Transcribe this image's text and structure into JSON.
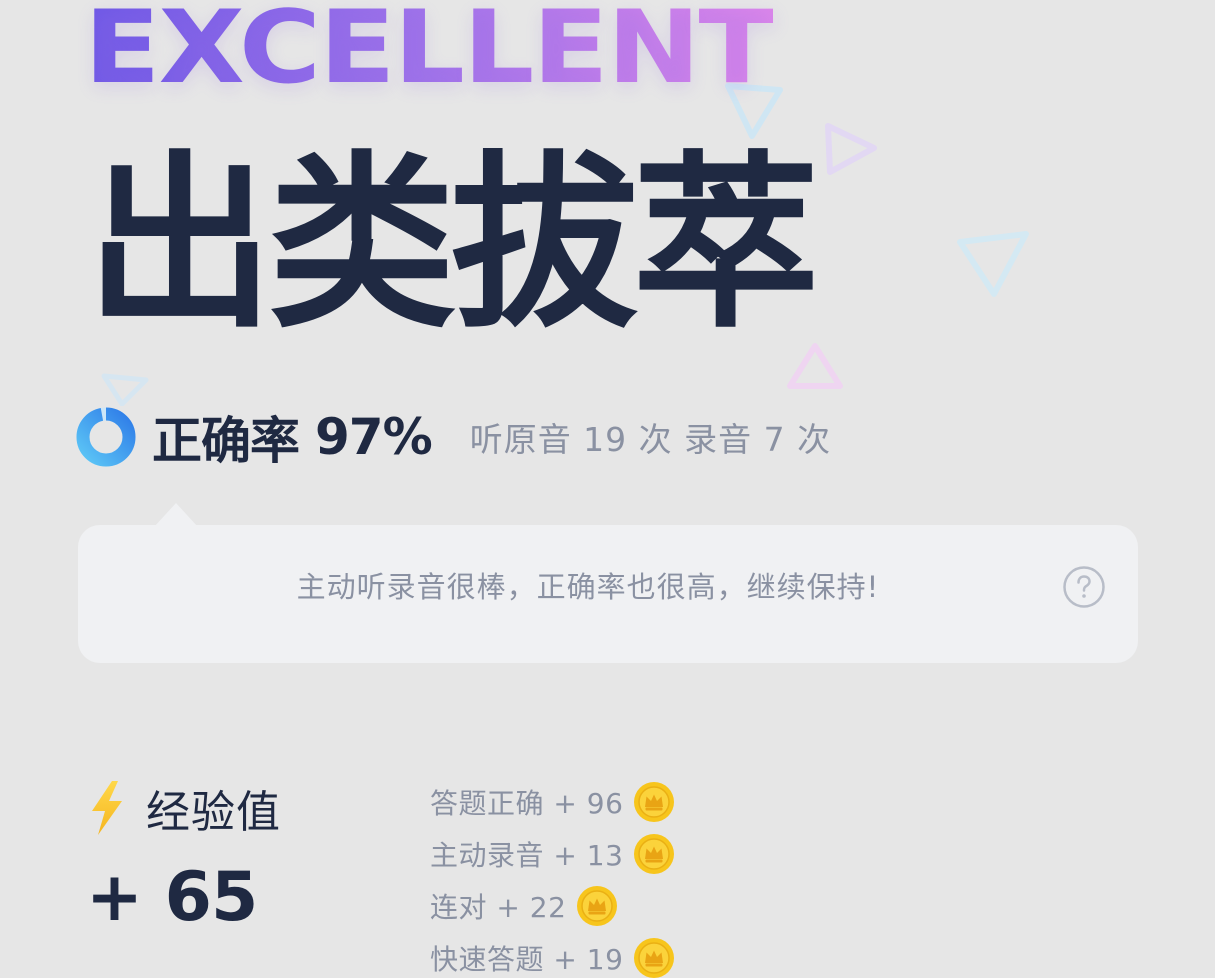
{
  "header": {
    "badge_text": "EXCELLENT",
    "title": "出类拔萃"
  },
  "accuracy": {
    "label": "正确率",
    "value": "97%",
    "percent": 97,
    "listen_stats": "听原音 19 次 录音 7 次"
  },
  "tip": {
    "text": "主动听录音很棒，正确率也很高，继续保持!",
    "help_icon": "question-circle-icon"
  },
  "experience": {
    "label": "经验值",
    "total": "+ 65",
    "icon": "lightning-icon",
    "bonuses": [
      {
        "label": "答题正确 + 96",
        "icon": "crown-coin-icon"
      },
      {
        "label": "主动录音 + 13",
        "icon": "crown-coin-icon"
      },
      {
        "label": "连对 + 22",
        "icon": "crown-coin-icon"
      },
      {
        "label": "快速答题 + 19",
        "icon": "crown-coin-icon"
      }
    ]
  },
  "colors": {
    "background": "#e6e6e6",
    "title": "#1f2942",
    "muted_text": "#8a91a2",
    "accent_blue": "#3a8ef0",
    "gradient_start": "#6e58e6",
    "gradient_end": "#dc86ea",
    "coin_gold": "#f7c51c"
  }
}
